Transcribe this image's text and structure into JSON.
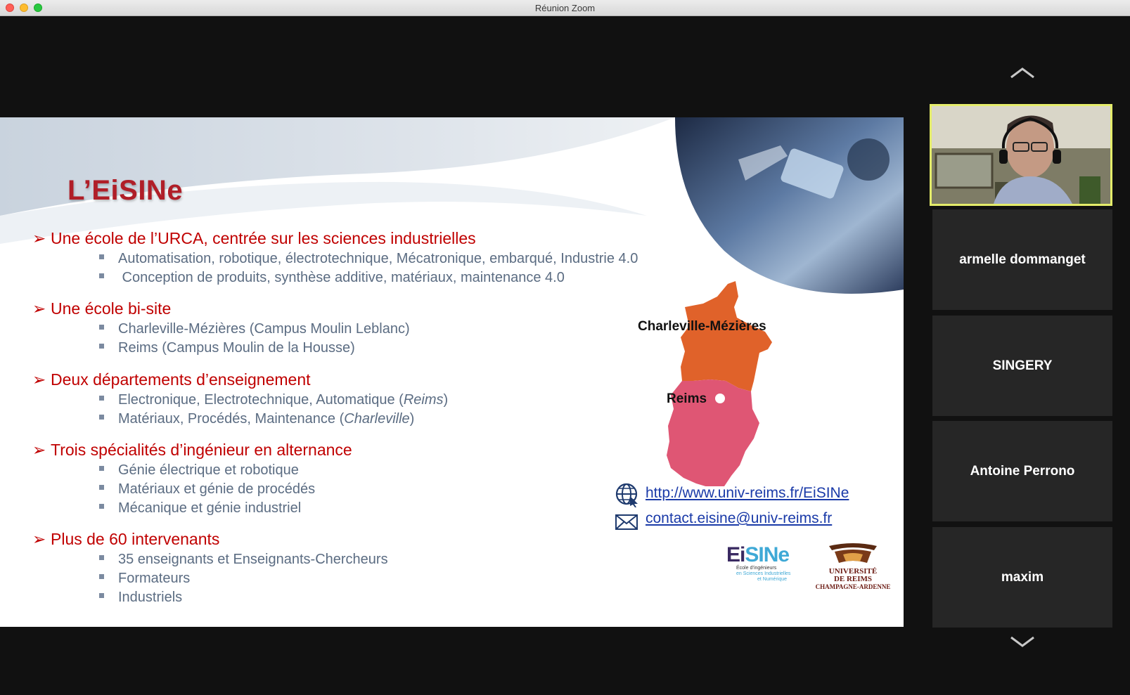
{
  "window": {
    "title": "Réunion Zoom"
  },
  "slide": {
    "title": "L’EiSINe",
    "sections": [
      {
        "heading": "Une école de l’URCA, centrée sur les sciences industrielles",
        "items": [
          "Automatisation, robotique, électrotechnique, Mécatronique, embarqué, Industrie 4.0",
          " Conception de produits, synthèse additive, matériaux, maintenance 4.0"
        ]
      },
      {
        "heading": "Une école bi-site",
        "items": [
          "Charleville-Mézières (Campus Moulin Leblanc)",
          "Reims (Campus Moulin de la Housse)"
        ]
      },
      {
        "heading": "Deux départements d’enseignement",
        "items": [
          {
            "text": "Electronique, Electrotechnique, Automatique (",
            "italic": "Reims",
            "tail": ")"
          },
          {
            "text": "Matériaux, Procédés, Maintenance (",
            "italic": "Charleville",
            "tail": ")"
          }
        ]
      },
      {
        "heading": "Trois spécialités d’ingénieur en alternance",
        "items": [
          "Génie électrique et robotique",
          "Matériaux et génie de procédés",
          "Mécanique et génie industriel"
        ]
      },
      {
        "heading": "Plus de 60 intervenants",
        "items": [
          "35 enseignants et Enseignants-Chercheurs",
          "Formateurs",
          "Industriels"
        ]
      }
    ],
    "map": {
      "city_north": "Charleville-Mézières",
      "city_south": "Reims",
      "colors": {
        "north": "#e0622a",
        "south": "#df5674"
      }
    },
    "website": "http://www.univ-reims.fr/EiSINe",
    "email": "contact.eisine@univ-reims.fr",
    "logos": {
      "eisine": {
        "name": "EiSINe",
        "subtitle1": "École d’ingénieurs",
        "subtitle2": "en Sciences Industrielles",
        "subtitle3": "et Numérique"
      },
      "urca": {
        "line1": "UNIVERSITÉ",
        "line2": "DE REIMS",
        "line3": "CHAMPAGNE-ARDENNE"
      }
    }
  },
  "gallery": {
    "participants": [
      "armelle dommanget",
      "SINGERY",
      "Antoine Perrono",
      "maxim"
    ],
    "active_border_color": "#e4ec6a"
  }
}
